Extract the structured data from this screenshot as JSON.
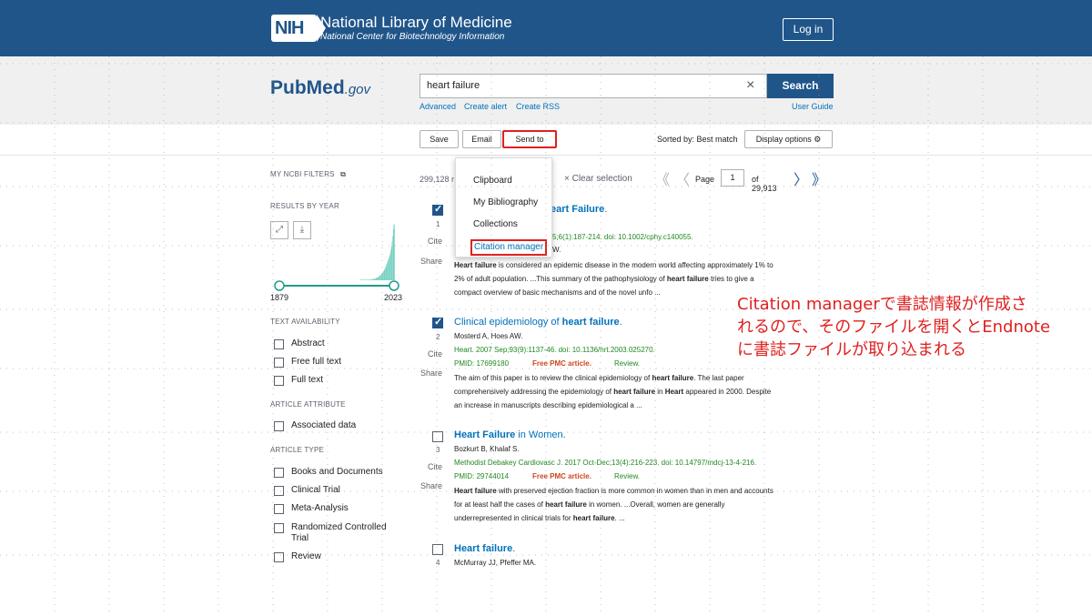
{
  "nih": {
    "logo_text": "NIH",
    "title": "National Library of Medicine",
    "subtitle": "National Center for Biotechnology Information",
    "login_label": "Log in"
  },
  "search": {
    "logo_pub": "Pub",
    "logo_med": "Med",
    "logo_gov": ".gov",
    "query": "heart failure",
    "clear_icon": "×",
    "search_label": "Search",
    "advanced_label": "Advanced",
    "create_alert_label": "Create alert",
    "create_rss_label": "Create RSS",
    "user_guide_label": "User Guide"
  },
  "toolbar": {
    "save_label": "Save",
    "email_label": "Email",
    "sendto_label": "Send to",
    "sorted_by_label": "Sorted by: Best match",
    "display_options_label": "Display options",
    "gear_icon": "⚙"
  },
  "sendto_menu": {
    "items": [
      "Clipboard",
      "My Bibliography",
      "Collections",
      "Citation manager"
    ]
  },
  "filters": {
    "my_ncbi_label": "MY NCBI FILTERS",
    "external_icon": "⧉",
    "results_by_year_label": "RESULTS BY YEAR",
    "expand_icon": "⤢",
    "download_icon": "⤓",
    "year_start": "1879",
    "year_end": "2023",
    "text_availability_label": "TEXT AVAILABILITY",
    "text_availability": [
      "Abstract",
      "Free full text",
      "Full text"
    ],
    "article_attribute_label": "ARTICLE ATTRIBUTE",
    "article_attribute": [
      "Associated data"
    ],
    "article_type_label": "ARTICLE TYPE",
    "article_type": [
      "Books and Documents",
      "Clinical Trial",
      "Meta-Analysis",
      "Randomized Controlled",
      "Trial",
      "Review"
    ]
  },
  "results_header": {
    "count": "299,128 r",
    "clear_selection": "× Clear selection",
    "first_icon": "《",
    "prev_icon": "〈",
    "page_label": "Page",
    "page_value": "1",
    "page_of": "of 29,913",
    "next_icon": "〉",
    "last_icon": "》"
  },
  "results": [
    {
      "num": "1",
      "checked": true,
      "title_html_parts": [
        "",
        "eart Failure",
        "."
      ],
      "citation": "5;6(1):187-214. doi: 10.1002/cphy.c140055.",
      "authors_tail": "W.",
      "snippet_lines": [
        [
          "Heart failure",
          " is considered an epidemic disease in the modern world affecting approximately 1% to"
        ],
        [
          "",
          "2% of adult population. ...This summary of the pathophysiology of ",
          "heart failure",
          " tries to give a"
        ],
        [
          "",
          "compact overview of basic mechanisms and of the novel unfo ..."
        ]
      ]
    },
    {
      "num": "2",
      "checked": true,
      "title_pre": "Clinical epidemiology of ",
      "title_bold": "heart failure",
      "title_post": ".",
      "authors": "Mosterd A, Hoes AW.",
      "citation": "Heart. 2007 Sep;93(9):1137-46. doi: 10.1136/hrt.2003.025270.",
      "pmid": "PMID: 17699180",
      "pmc": "Free PMC article.",
      "type": "Review.",
      "snippet_1a": "The aim of this paper is to review the clinical epidemiology of ",
      "snippet_1b": "heart failure",
      "snippet_1c": ". The last paper",
      "snippet_2a": "comprehensively addressing the epidemiology of ",
      "snippet_2b": "heart failure",
      "snippet_2c": " in ",
      "snippet_2d": "Heart",
      "snippet_2e": " appeared in 2000. Despite",
      "snippet_3": "an increase in manuscripts describing epidemiological a ..."
    },
    {
      "num": "3",
      "checked": false,
      "title_bold": "Heart Failure",
      "title_post": " in Women.",
      "authors": "Bozkurt B, Khalaf S.",
      "citation": "Methodist Debakey Cardiovasc J. 2017 Oct-Dec;13(4):216-223. doi: 10.14797/mdcj-13-4-216.",
      "pmid": "PMID: 29744014",
      "pmc": "Free PMC article.",
      "type": "Review.",
      "snippet_1a": "Heart failure",
      "snippet_1b": " with preserved ejection fraction is more common in women than in men and accounts",
      "snippet_2a": "for at least half the cases of ",
      "snippet_2b": "heart failure",
      "snippet_2c": " in women. ...Overall, women are generally",
      "snippet_3a": "underrepresented in clinical trials for ",
      "snippet_3b": "heart failure",
      "snippet_3c": ". ..."
    },
    {
      "num": "4",
      "checked": false,
      "title_bold": "Heart failure",
      "title_post": ".",
      "authors": "McMurray JJ, Pfeffer MA."
    }
  ],
  "result_side": {
    "cite_label": "Cite",
    "share_label": "Share"
  },
  "annotation": {
    "line1": "Citation managerで書誌情報が作成さ",
    "line2": "れるので、そのファイルを開くとEndnote",
    "line3": "に書誌ファイルが取り込まれる"
  },
  "histogram_values": [
    1,
    1,
    1,
    1,
    1,
    1,
    1,
    1,
    1,
    1,
    1,
    1,
    1,
    1,
    1,
    1,
    1,
    2,
    2,
    2,
    2,
    2,
    3,
    3,
    3,
    4,
    4,
    5,
    5,
    6,
    7,
    8,
    9,
    10,
    11,
    12,
    14,
    16,
    18,
    20,
    22,
    25,
    28,
    31,
    34,
    37,
    40,
    44,
    48,
    54,
    60,
    68,
    78,
    90,
    100,
    98
  ],
  "colors": {
    "nih_blue": "#20558a",
    "link_blue": "#0071bc",
    "annotation_red": "#e02020",
    "histogram_teal": "#5bc8b5"
  }
}
